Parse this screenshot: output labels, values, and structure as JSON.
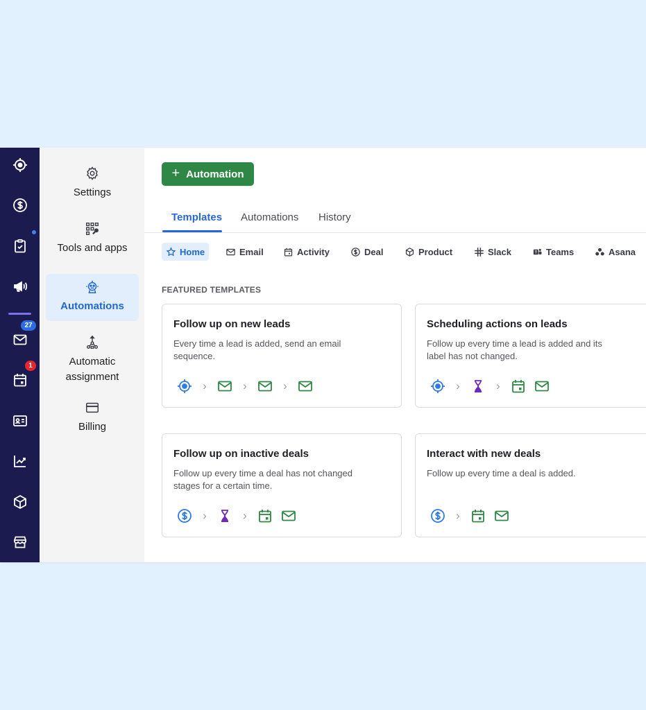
{
  "rail": {
    "items": [
      {
        "icon": "target-icon",
        "name": "rail-leads"
      },
      {
        "icon": "dollar-circle-icon",
        "name": "rail-deals"
      },
      {
        "icon": "clipboard-check-icon",
        "name": "rail-tasks"
      },
      {
        "icon": "megaphone-icon",
        "name": "rail-campaigns"
      },
      {
        "icon": "mail-icon",
        "name": "rail-mail"
      },
      {
        "icon": "calendar-icon",
        "name": "rail-activities"
      },
      {
        "icon": "contact-card-icon",
        "name": "rail-contacts"
      },
      {
        "icon": "chart-trend-icon",
        "name": "rail-insights"
      },
      {
        "icon": "box-icon",
        "name": "rail-products"
      },
      {
        "icon": "store-icon",
        "name": "rail-marketplace"
      }
    ],
    "mail_badge": "27",
    "activities_badge": "1",
    "colors": {
      "background": "#1c1b4f",
      "mail_badge": "#2d6ce5",
      "activities_badge": "#e6262f"
    }
  },
  "settings_nav": {
    "items": [
      {
        "label": "Settings",
        "icon": "gear-icon"
      },
      {
        "label": "Tools and apps",
        "icon": "tools-grid-icon"
      },
      {
        "label": "Automations",
        "icon": "automation-robot-icon",
        "active": true
      },
      {
        "label": "Automatic assignment",
        "icon": "assignment-tree-icon"
      },
      {
        "label": "Billing",
        "icon": "credit-card-icon"
      }
    ]
  },
  "main": {
    "add_button": {
      "label": "Automation",
      "icon": "plus-icon",
      "color": "#2e8744"
    },
    "tabs": [
      {
        "label": "Templates",
        "active": true
      },
      {
        "label": "Automations"
      },
      {
        "label": "History"
      }
    ],
    "filters": [
      {
        "label": "Home",
        "icon": "star-icon",
        "active": true
      },
      {
        "label": "Email",
        "icon": "mail-icon"
      },
      {
        "label": "Activity",
        "icon": "calendar-icon"
      },
      {
        "label": "Deal",
        "icon": "dollar-circle-icon"
      },
      {
        "label": "Product",
        "icon": "box-icon"
      },
      {
        "label": "Slack",
        "icon": "slack-icon"
      },
      {
        "label": "Teams",
        "icon": "teams-icon"
      },
      {
        "label": "Asana",
        "icon": "asana-icon"
      }
    ],
    "section_title": "FEATURED TEMPLATES",
    "templates": [
      {
        "title": "Follow up on new leads",
        "description": "Every time a lead is added, send an email sequence.",
        "flow": [
          "target-icon",
          "mail-icon",
          "mail-icon",
          "mail-icon"
        ]
      },
      {
        "title": "Scheduling actions on leads",
        "description": "Follow up every time a lead is added and its label has not changed.",
        "flow": [
          "target-icon",
          "hourglass-icon",
          "calendar-icon",
          "mail-icon"
        ]
      },
      {
        "title": "Follow up on inactive deals",
        "description": "Follow up every time a deal has not changed stages for a certain time.",
        "flow": [
          "dollar-circle-icon",
          "hourglass-icon",
          "calendar-icon",
          "mail-icon"
        ]
      },
      {
        "title": "Interact with new deals",
        "description": "Follow up every time a deal is added.",
        "flow": [
          "dollar-circle-icon",
          "calendar-icon",
          "mail-icon"
        ]
      }
    ],
    "colors": {
      "accent": "#2667d4",
      "flow_green": "#2e8744",
      "flow_purple": "#6c2bb8",
      "flow_blue": "#2f7be6"
    }
  }
}
